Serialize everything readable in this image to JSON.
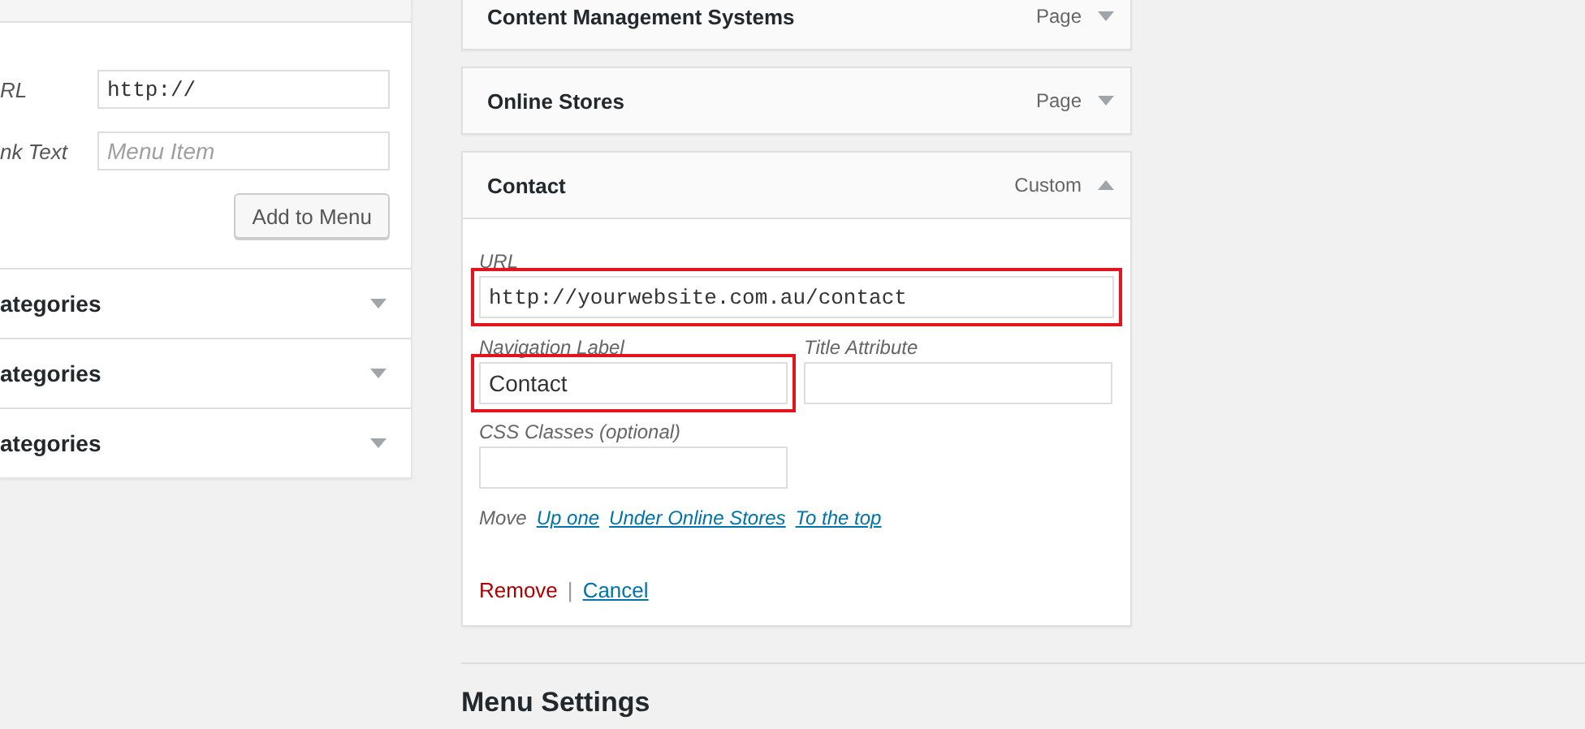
{
  "custom_links": {
    "url_label": "RL",
    "url_value": "http://",
    "link_text_label": "nk Text",
    "link_text_placeholder": "Menu Item",
    "add_button": "Add to Menu"
  },
  "left_sections": [
    {
      "title": "ategories",
      "expanded": false
    },
    {
      "title": "ategories",
      "expanded": false
    },
    {
      "title": "ategories",
      "expanded": false
    }
  ],
  "menu_items": [
    {
      "title": "Content Management Systems",
      "type": "Page",
      "expanded": false
    },
    {
      "title": "Online Stores",
      "type": "Page",
      "expanded": false
    },
    {
      "title": "Contact",
      "type": "Custom",
      "expanded": true,
      "fields": {
        "url": {
          "label": "URL",
          "value": "http://yourwebsite.com.au/contact",
          "highlighted": true
        },
        "navigation_label": {
          "label": "Navigation Label",
          "value": "Contact",
          "highlighted": true
        },
        "title_attribute": {
          "label": "Title Attribute",
          "highlighted": false
        },
        "css_classes": {
          "label": "CSS Classes (optional)",
          "highlighted": false
        }
      },
      "move_label": "Move",
      "move_links": [
        "Up one",
        "Under Online Stores",
        "To the top"
      ],
      "remove": "Remove",
      "separator": "|",
      "cancel": "Cancel"
    }
  ],
  "menu_settings_heading": "Menu Settings"
}
